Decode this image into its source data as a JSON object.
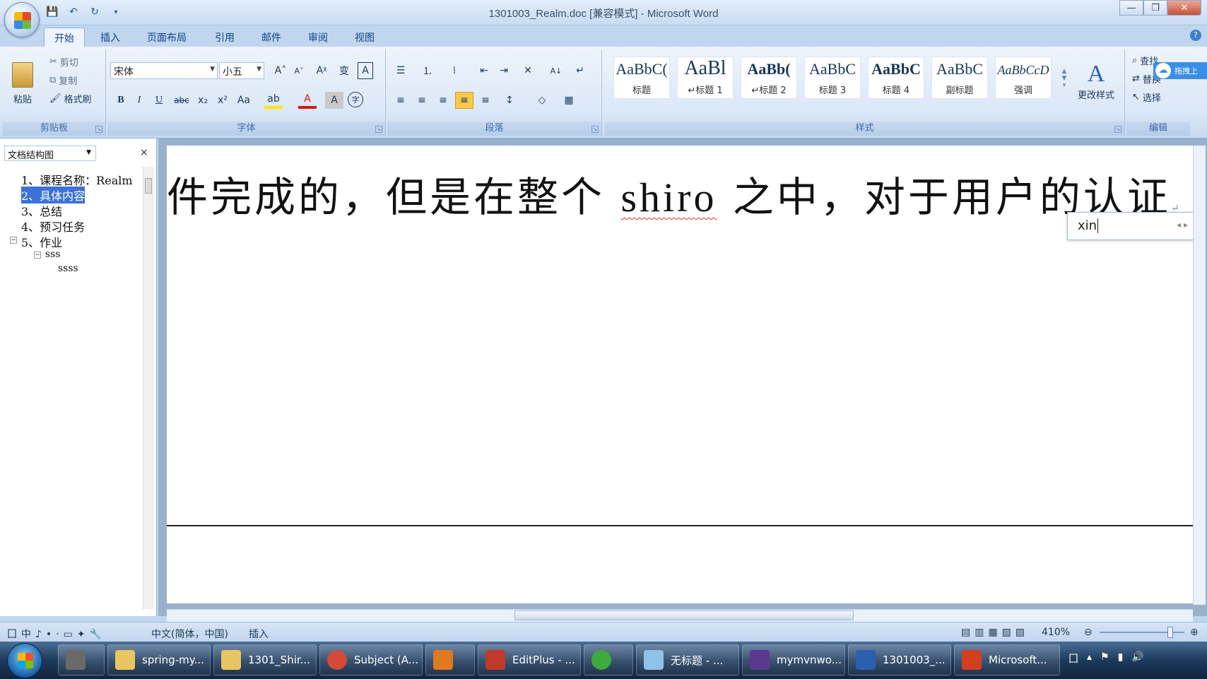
{
  "window": {
    "title": "1301003_Realm.doc [兼容模式] - Microsoft Word",
    "min_label": "—",
    "max_label": "❐",
    "close_label": "✕"
  },
  "qat": {
    "save": "💾",
    "undo": "↶",
    "redo": "↻",
    "more": "▾"
  },
  "tabs": [
    "开始",
    "插入",
    "页面布局",
    "引用",
    "邮件",
    "审阅",
    "视图"
  ],
  "help": "?",
  "clipboard": {
    "paste": "粘贴",
    "cut": "剪切",
    "copy": "复制",
    "format_painter": "格式刷",
    "label": "剪贴板"
  },
  "font": {
    "name": "宋体",
    "size": "小五",
    "label": "字体",
    "grow": "A˄",
    "shrink": "A˅",
    "clear": "Aᵡ",
    "phonetic": "变",
    "border": "A",
    "bold": "B",
    "italic": "I",
    "underline": "U",
    "strike": "abc",
    "sub": "x₂",
    "sup": "x²",
    "case": "Aa",
    "highlight": "ab",
    "color": "A",
    "shade": "A",
    "enclose": "字"
  },
  "paragraph": {
    "label": "段落",
    "bullets": "☰",
    "numbering": "⒈",
    "multilevel": "⁞",
    "dec_indent": "⇤",
    "inc_indent": "⇥",
    "chinese_layout": "✕",
    "sort": "A↓",
    "marks": "↵",
    "align_left": "≡",
    "center": "≡",
    "align_right": "≡",
    "justify": "≡",
    "distribute": "≡",
    "line_spacing": "↕",
    "shading": "◇",
    "borders": "▦"
  },
  "styles": {
    "label": "样式",
    "items": [
      {
        "sample": "AaBbC(",
        "name": "标题"
      },
      {
        "sample": "AaBl",
        "name": "↵标题 1"
      },
      {
        "sample": "AaBb(",
        "name": "↵标题 2"
      },
      {
        "sample": "AaBbC",
        "name": "标题 3"
      },
      {
        "sample": "AaBbC",
        "name": "标题 4"
      },
      {
        "sample": "AaBbC",
        "name": "副标题"
      },
      {
        "sample": "AaBbCcD",
        "name": "强调"
      }
    ],
    "change_styles": "更改样式"
  },
  "editing": {
    "label": "编辑",
    "find": "查找",
    "replace": "替换",
    "select": "选择"
  },
  "cloud_tag": "拖拽上",
  "nav": {
    "view": "文档结构图",
    "close": "×",
    "items": [
      {
        "text": "1、课程名称：Realm"
      },
      {
        "text": "2、具体内容"
      },
      {
        "text": "3、总结"
      },
      {
        "text": "4、预习任务"
      },
      {
        "text": "5、作业"
      },
      {
        "text": "sss"
      },
      {
        "text": "ssss"
      }
    ],
    "toggle_minus": "−"
  },
  "document": {
    "text_before": "件完成的，但是在整个 ",
    "text_eng": "shiro",
    "text_after": " 之中，对于用户的认证",
    "para_mark": "↵"
  },
  "ime": {
    "input": "xin",
    "arrows": "◂ ▸"
  },
  "status": {
    "language": "中文(简体，中国)",
    "mode": "插入",
    "zoom": "410%"
  },
  "taskbar": [
    {
      "label": "spring-my...",
      "color": "#e8c562"
    },
    {
      "label": "1301_Shir...",
      "color": "#e8c562"
    },
    {
      "label": "Subject (A...",
      "color": "#d44a3a"
    },
    {
      "label": "",
      "color": "#e07a1f"
    },
    {
      "label": "EditPlus - ...",
      "color": "#c03a2b"
    },
    {
      "label": "",
      "color": "#3caa3c"
    },
    {
      "label": "无标题 - ...",
      "color": "#8ec2e6"
    },
    {
      "label": "mymvnwo...",
      "color": "#5a3a8c"
    },
    {
      "label": "1301003_...",
      "color": "#2b5fb0"
    },
    {
      "label": "Microsoft...",
      "color": "#d2401f"
    }
  ]
}
